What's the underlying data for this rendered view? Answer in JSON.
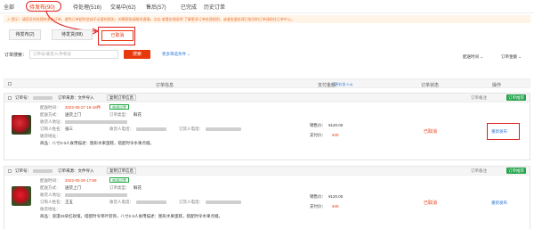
{
  "tabs": [
    {
      "label": "全部"
    },
    {
      "label": "待发布(90)"
    },
    {
      "label": "待处理(516)"
    },
    {
      "label": "交易中(62)"
    },
    {
      "label": "售后(57)"
    },
    {
      "label": "已完成"
    },
    {
      "label": "历史订单"
    }
  ],
  "notice": {
    "text": "⚠ 提示：请您及时处理待发布订单，避免订单超时造成不必要的损失；如需帮助请联系客服，点击 查看处理说明 了解更多订单处理规则，或者批量处理已取消的订单请前往订单中心。"
  },
  "subtabs": [
    {
      "label": "待发布(2)"
    },
    {
      "label": "待发货(88)"
    },
    {
      "label": "已取消"
    }
  ],
  "search": {
    "label": "订单搜索：",
    "placeholder": "订单号/收货人/手机号",
    "button": "搜索",
    "more": "更多筛选条件 ⌄",
    "sort_time": "配送时间 ⌄",
    "sort_amount": "订单金额 ⌄"
  },
  "table": {
    "headers": [
      "订单信息",
      "支付金额",
      "订单状态",
      "操作"
    ],
    "price_basis": "(原价含 0.4)"
  },
  "orders": [
    {
      "order_no_label": "订单号：",
      "source_label": "订单来源：文件导入",
      "copy_label": "复制订单信息",
      "delivery_time_label": "配送时间：",
      "delivery_time": "2022-05-27 16-18件",
      "tag": "普通设置",
      "method_label": "配送方式：",
      "method": "送货上门",
      "category_label": "订单类型：",
      "category": "鲜花",
      "receiver_label": "收货人地址：",
      "buyer_label": "订购人姓名：",
      "buyer": "张三",
      "contact_label": "收货人电话：",
      "phone_label": "订货人电话：",
      "address_label": "收货地址：",
      "note": "商品：八寸2-3人食用描述：图形水果蛋糕，搭配时令水果点缀。",
      "price_label": "销售价：",
      "price": "¥120.00",
      "pay_label": "支付价：",
      "pay": "¥40",
      "status": "已取消",
      "action": "重新发布",
      "flag": "订单备注",
      "green_btn": "订单推荐"
    },
    {
      "order_no_label": "订单号：",
      "source_label": "订单来源：文件导入",
      "copy_label": "复制订单信息",
      "delivery_time_label": "配送时间：",
      "delivery_time": "2022-05-26 17:59",
      "tag": "普通设置",
      "method_label": "配送方式：",
      "method": "送货上门",
      "category_label": "订单类型：",
      "category": "鲜花",
      "receiver_label": "收货人地址：",
      "buyer_label": "订购人姓名：",
      "buyer": "王五",
      "contact_label": "收货人电话：",
      "phone_label": "订货人电话：",
      "address_label": "收货地址：",
      "note": "商品：浪漫33朵红玫瑰，搭配时令草叶装饰，八寸2-3人食用描述：图形水果蛋糕，搭配时令水果点缀。",
      "price_label": "销售价：",
      "price": "¥120.00",
      "pay_label": "支付价：",
      "pay": "¥40",
      "status": "已取消",
      "action": "重新发布",
      "flag": "订单备注",
      "green_btn": "订单推荐"
    }
  ]
}
